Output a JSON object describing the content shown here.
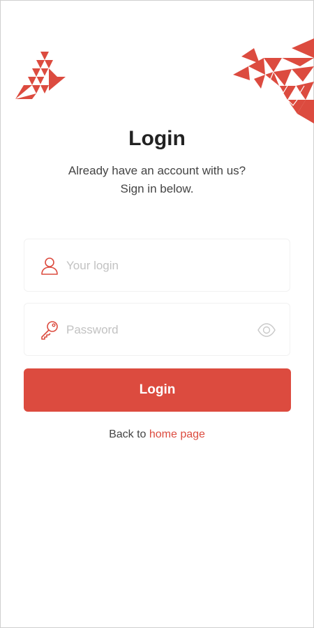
{
  "title": "Login",
  "subtitle_line1": "Already have an account with us?",
  "subtitle_line2": "Sign in below.",
  "login_field": {
    "placeholder": "Your login",
    "value": "",
    "icon": "user-icon"
  },
  "password_field": {
    "placeholder": "Password",
    "value": "",
    "icon": "key-icon",
    "toggle_icon": "eye-icon"
  },
  "login_button": "Login",
  "back_prefix": "Back to",
  "back_link": "home page",
  "colors": {
    "accent": "#dc4b3f",
    "text": "#222222",
    "muted": "#c2c2c2"
  }
}
